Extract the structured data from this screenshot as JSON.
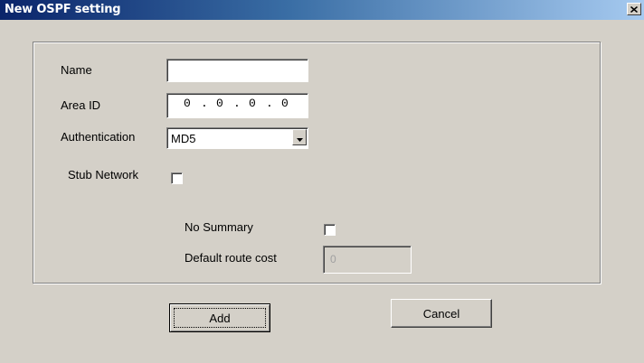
{
  "window": {
    "title": "New OSPF setting"
  },
  "form": {
    "name": {
      "label": "Name",
      "value": ""
    },
    "area_id": {
      "label": "Area ID",
      "octets": [
        "0",
        "0",
        "0",
        "0"
      ]
    },
    "authentication": {
      "label": "Authentication",
      "selected": "MD5"
    },
    "stub_network": {
      "label": "Stub Network",
      "checked": false
    },
    "no_summary": {
      "label": "No Summary",
      "checked": false
    },
    "default_route_cost": {
      "label": "Default route cost",
      "value": "0",
      "enabled": false
    }
  },
  "buttons": {
    "add": "Add",
    "cancel": "Cancel"
  },
  "icons": {
    "close": "close-icon",
    "dropdown": "chevron-down-icon"
  },
  "colors": {
    "title_gradient_start": "#0a246a",
    "title_gradient_end": "#a6caf0",
    "dialog_face": "#d4d0c8"
  }
}
